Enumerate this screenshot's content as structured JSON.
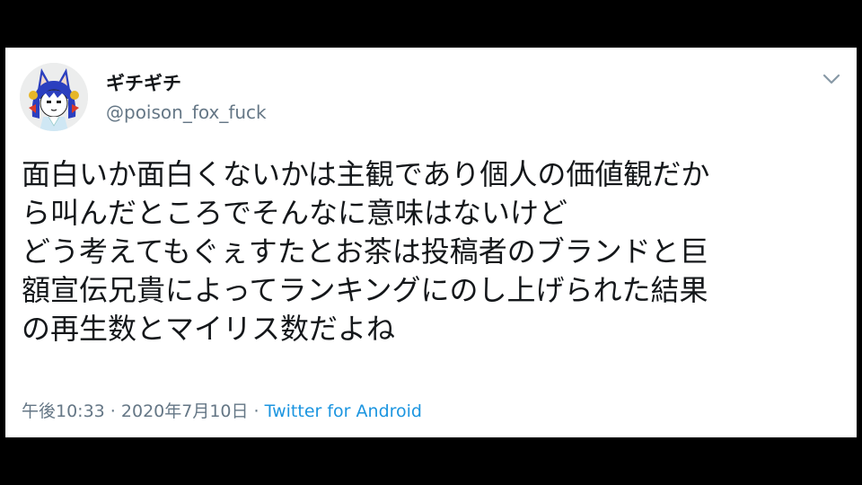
{
  "tweet": {
    "display_name": "ギチギチ",
    "handle": "@poison_fox_fuck",
    "avatar_icon": "fox-girl-avatar-icon",
    "menu_icon": "chevron-down-icon",
    "text_lines": [
      "面白いか面白くないかは主観であり個人の価値観だか",
      "ら叫んだところでそんなに意味はないけど",
      "どう考えてもぐぇすたとお茶は投稿者のブランドと巨",
      "額宣伝兄貴によってランキングにのし上げられた結果",
      "の再生数とマイリス数だよね"
    ],
    "time": "午後10:33",
    "separator": " · ",
    "date": "2020年7月10日",
    "source": "Twitter for Android"
  },
  "colors": {
    "background": "#000000",
    "card": "#ffffff",
    "text": "#14171a",
    "secondary": "#657786",
    "link": "#1b95e0"
  }
}
